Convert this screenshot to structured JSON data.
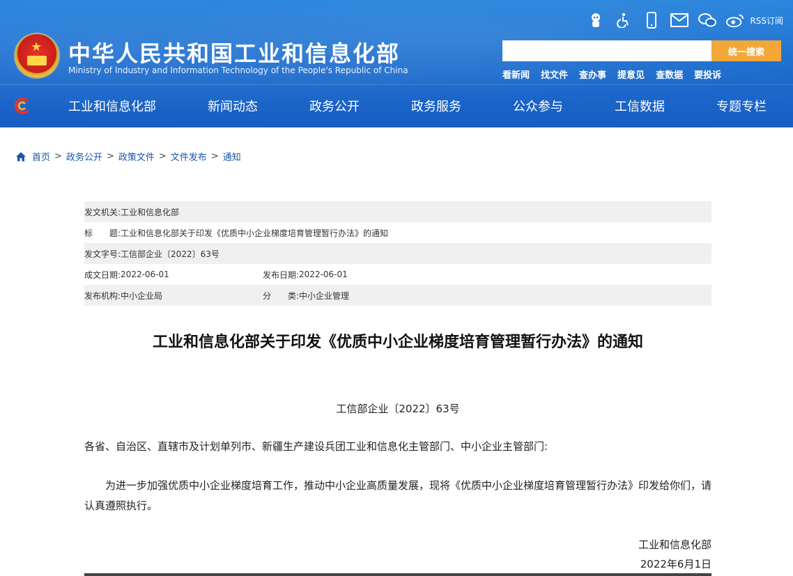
{
  "header": {
    "title": "中华人民共和国工业和信息化部",
    "subtitle": "Ministry of Industry and Information Technology of the People's Republic of China",
    "rss_label": "RSS订阅",
    "search": {
      "value": "",
      "button": "统一搜索"
    },
    "quick_links": [
      "看新闻",
      "找文件",
      "查办事",
      "提意见",
      "查数据",
      "要投诉"
    ],
    "icons": [
      "robot-icon",
      "accessibility-icon",
      "mobile-icon",
      "mail-icon",
      "wechat-icon",
      "weibo-icon"
    ],
    "brand_color": "#1d6fd0",
    "accent_color": "#f3a739"
  },
  "nav": {
    "items": [
      "工业和信息化部",
      "新闻动态",
      "政务公开",
      "政务服务",
      "公众参与",
      "工信数据",
      "专题专栏"
    ]
  },
  "breadcrumb": [
    "首页",
    "政务公开",
    "政策文件",
    "文件发布",
    "通知"
  ],
  "meta": {
    "issuer_label": "发文机关:",
    "issuer": "工业和信息化部",
    "title_label": "标　　题:",
    "title": "工业和信息化部关于印发《优质中小企业梯度培育管理暂行办法》的通知",
    "doc_no_label": "发文字号:",
    "doc_no": "工信部企业〔2022〕63号",
    "written_date_label": "成文日期:",
    "written_date": "2022-06-01",
    "publish_date_label": "发布日期:",
    "publish_date": "2022-06-01",
    "org_label": "发布机构:",
    "org": "中小企业局",
    "category_label": "分　　类:",
    "category": "中小企业管理"
  },
  "article": {
    "title": "工业和信息化部关于印发《优质中小企业梯度培育管理暂行办法》的通知",
    "doc_number": "工信部企业〔2022〕63号",
    "addressee": "各省、自治区、直辖市及计划单列市、新疆生产建设兵团工业和信息化主管部门、中小企业主管部门:",
    "body": "为进一步加强优质中小企业梯度培育工作，推动中小企业高质量发展，现将《优质中小企业梯度培育管理暂行办法》印发给你们，请认真遵照执行。",
    "signature": "工业和信息化部",
    "date": "2022年6月1日"
  }
}
